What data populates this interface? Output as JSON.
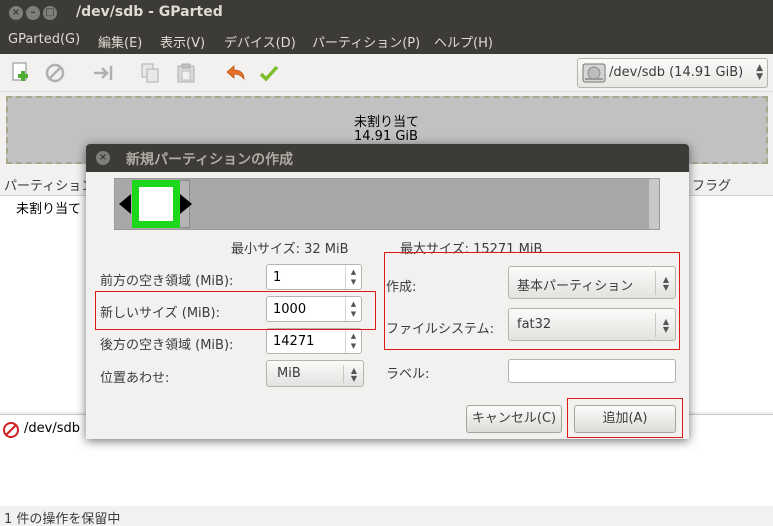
{
  "window": {
    "title": "/dev/sdb - GParted",
    "controls": [
      "close-icon",
      "minimize-icon",
      "maximize-icon"
    ]
  },
  "menubar": [
    "GParted(G)",
    "編集(E)",
    "表示(V)",
    "デバイス(D)",
    "パーティション(P)",
    "ヘルプ(H)"
  ],
  "toolbar": {
    "icons": [
      "new-partition-icon",
      "delete-icon",
      "resize-move-icon",
      "copy-icon",
      "paste-icon",
      "undo-icon",
      "apply-icon"
    ],
    "device": "/dev/sdb  (14.91 GiB)"
  },
  "diskmap": {
    "label": "未割り当て",
    "size": "14.91 GiB"
  },
  "partition_list": {
    "header_partition": "パーティション",
    "header_flags": "フラグ",
    "row_label": "未割り当て"
  },
  "operations": {
    "item": "/dev/sdb"
  },
  "status": "1 件の操作を保留中",
  "dialog": {
    "title": "新規パーティションの作成",
    "min_size": "最小サイズ: 32 MiB",
    "max_size": "最大サイズ: 15271 MiB",
    "free_before_label": "前方の空き領域 (MiB):",
    "free_before_value": "1",
    "new_size_label": "新しいサイズ (MiB):",
    "new_size_value": "1000",
    "free_after_label": "後方の空き領域 (MiB):",
    "free_after_value": "14271",
    "align_label": "位置あわせ:",
    "align_value": "MiB",
    "create_as_label": "作成:",
    "create_as_value": "基本パーティション",
    "filesystem_label": "ファイルシステム:",
    "filesystem_value": "fat32",
    "label_label": "ラベル:",
    "label_value": "",
    "cancel": "キャンセル(C)",
    "add": "追加(A)"
  },
  "colors": {
    "titlebar": "#3c3b37",
    "unallocated": "#c1c1c1",
    "fat32": "#1cd71c",
    "highlight": "#e01818"
  }
}
